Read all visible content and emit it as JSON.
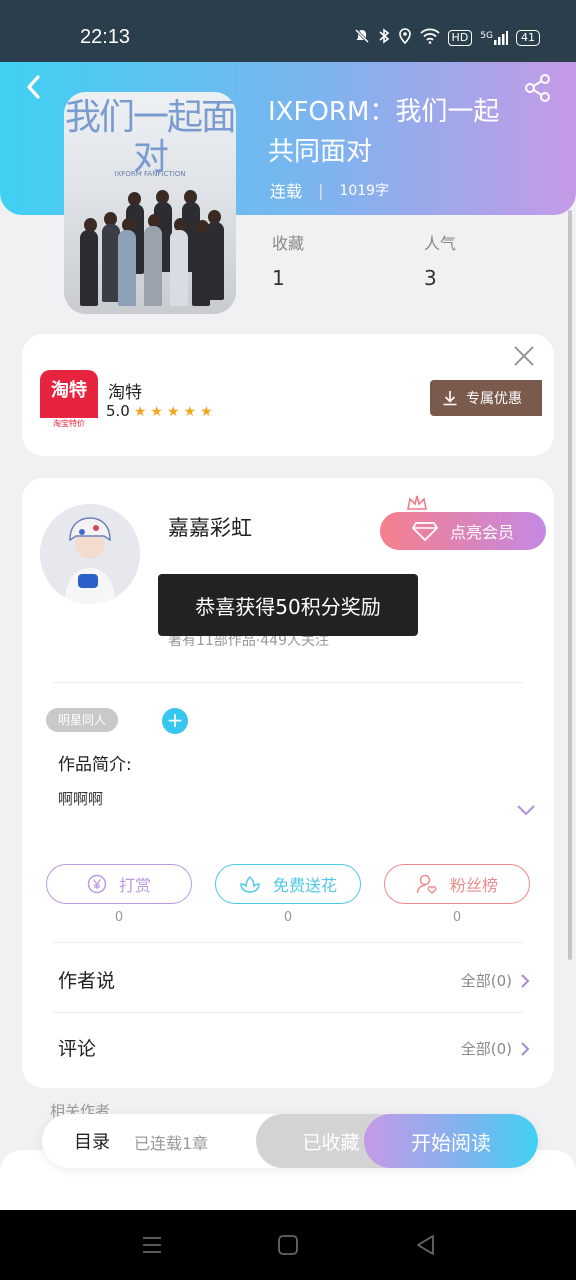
{
  "status_bar": {
    "time": "22:13",
    "hd": "HD",
    "signal": "5G",
    "battery": "41"
  },
  "book": {
    "cover_title": "我们一起面对",
    "cover_subtitle": "IXFORM FANFICTION",
    "title": "IXFORM：我们一起共同面对",
    "status": "连载",
    "word_count": "1019字",
    "collect_label": "收藏",
    "collect_value": "1",
    "popularity_label": "人气",
    "popularity_value": "3"
  },
  "ad": {
    "logo_text": "淘特",
    "logo_sub": "淘宝特价",
    "name": "淘特",
    "rating": "5.0",
    "stars": 5,
    "button_label": "专属优惠"
  },
  "author": {
    "name": "嘉嘉彩虹",
    "vip_label": "点亮会员",
    "stats": "著有11部作品·449人关注",
    "toast": "恭喜获得50积分奖励"
  },
  "tags": {
    "tag1": "明星同人",
    "add": "+"
  },
  "intro": {
    "label": "作品简介:",
    "text": "啊啊啊"
  },
  "actions": [
    {
      "label": "打赏",
      "count": "0",
      "color": "#b99be0"
    },
    {
      "label": "免费送花",
      "count": "0",
      "color": "#4fc9e9"
    },
    {
      "label": "粉丝榜",
      "count": "0",
      "color": "#ee8b8b"
    }
  ],
  "rows": {
    "author_says": "作者说",
    "author_says_all": "全部(0)",
    "comments": "评论",
    "comments_all": "全部(0)"
  },
  "peek_text": "相关作者",
  "bottom": {
    "toc": "目录",
    "toc_status": "已连载1章",
    "collected": "已收藏",
    "start_read": "开始阅读"
  }
}
